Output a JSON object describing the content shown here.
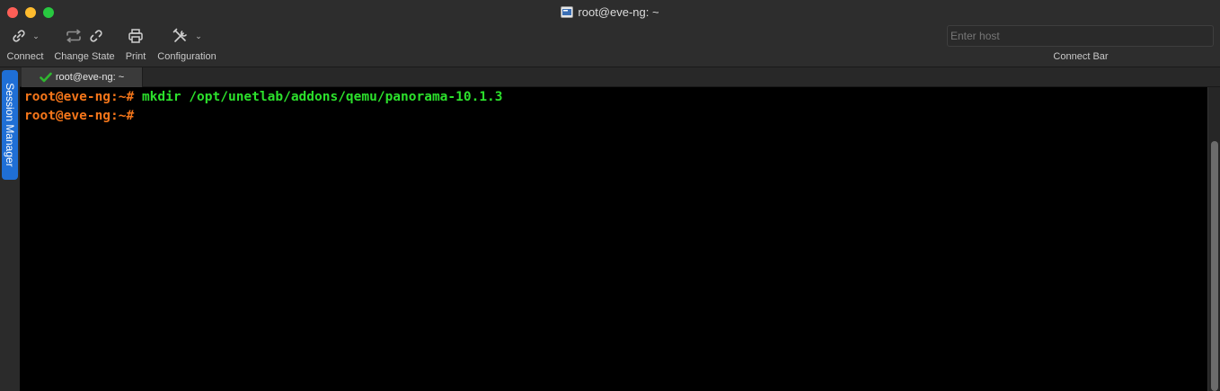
{
  "window": {
    "title": "root@eve-ng: ~"
  },
  "toolbar": {
    "connect_label": "Connect",
    "change_state_label": "Change State",
    "print_label": "Print",
    "configuration_label": "Configuration",
    "host_placeholder": "Enter host",
    "connect_bar_label": "Connect Bar"
  },
  "sidebar": {
    "session_manager_label": "Session Manager"
  },
  "tabs": [
    {
      "label": "root@eve-ng: ~",
      "status": "connected"
    }
  ],
  "terminal": {
    "lines": [
      {
        "prompt": "root@eve-ng:~#",
        "command": " mkdir /opt/unetlab/addons/qemu/panorama-10.1.3"
      },
      {
        "prompt": "root@eve-ng:~#",
        "command": ""
      }
    ]
  },
  "colors": {
    "prompt": "#f5761a",
    "command": "#2ce02c",
    "accent": "#1f6fd6",
    "check": "#2fb72f"
  }
}
